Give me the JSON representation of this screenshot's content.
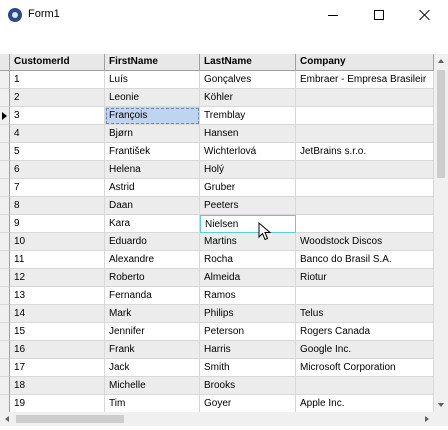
{
  "window": {
    "title": "Form1"
  },
  "columns": [
    "CustomerId",
    "FirstName",
    "LastName",
    "Company"
  ],
  "rows": [
    [
      "1",
      "Luís",
      "Gonçalves",
      "Embraer - Empresa Brasileir"
    ],
    [
      "2",
      "Leonie",
      "Köhler",
      ""
    ],
    [
      "3",
      "François",
      "Tremblay",
      ""
    ],
    [
      "4",
      "Bjørn",
      "Hansen",
      ""
    ],
    [
      "5",
      "František",
      "Wichterlová",
      "JetBrains s.r.o."
    ],
    [
      "6",
      "Helena",
      "Holý",
      ""
    ],
    [
      "7",
      "Astrid",
      "Gruber",
      ""
    ],
    [
      "8",
      "Daan",
      "Peeters",
      ""
    ],
    [
      "9",
      "Kara",
      "Nielsen",
      ""
    ],
    [
      "10",
      "Eduardo",
      "Martins",
      "Woodstock Discos"
    ],
    [
      "11",
      "Alexandre",
      "Rocha",
      "Banco do Brasil S.A."
    ],
    [
      "12",
      "Roberto",
      "Almeida",
      "Riotur"
    ],
    [
      "13",
      "Fernanda",
      "Ramos",
      ""
    ],
    [
      "14",
      "Mark",
      "Philips",
      "Telus"
    ],
    [
      "15",
      "Jennifer",
      "Peterson",
      "Rogers Canada"
    ],
    [
      "16",
      "Frank",
      "Harris",
      "Google Inc."
    ],
    [
      "17",
      "Jack",
      "Smith",
      "Microsoft Corporation"
    ],
    [
      "18",
      "Michelle",
      "Brooks",
      ""
    ],
    [
      "19",
      "Tim",
      "Goyer",
      "Apple Inc."
    ]
  ],
  "current_row": 3,
  "selected_cell": {
    "row": 3,
    "col": 1
  },
  "editing_cell": {
    "row": 9,
    "col": 2
  },
  "colors": {
    "header_bg": "#e8e8e8",
    "alt_row_bg": "#ececec",
    "selection_bg": "#bfd4ee",
    "edit_border": "#5ad0d6"
  },
  "icons": {
    "app": "app-icon",
    "minimize": "minimize-icon",
    "maximize": "maximize-icon",
    "close": "close-icon",
    "current_row": "row-pointer-icon",
    "cursor": "mouse-pointer-icon"
  }
}
